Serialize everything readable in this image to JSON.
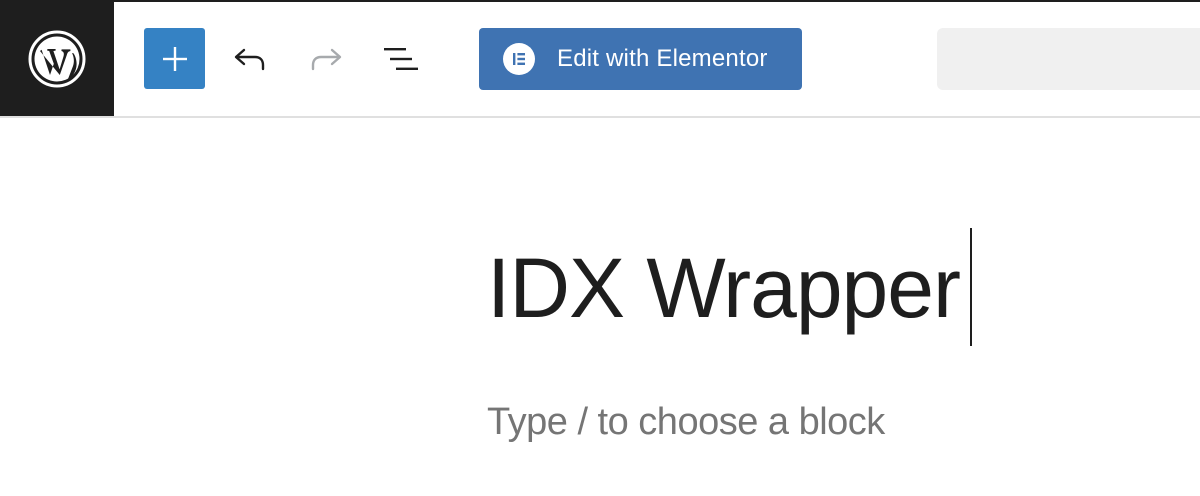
{
  "toolbar": {
    "logo_icon": "wordpress-logo-icon",
    "inserter_icon": "plus-icon",
    "undo_icon": "undo-arrow-icon",
    "redo_icon": "redo-arrow-icon",
    "outline_icon": "list-view-icon",
    "elementor_button_label": "Edit with Elementor",
    "elementor_icon": "elementor-icon",
    "search_placeholder": ""
  },
  "editor": {
    "title": "IDX Wrapper",
    "block_placeholder": "Type / to choose a block"
  },
  "colors": {
    "logo_background": "#1e1e1e",
    "inserter_blue": "#3582c4",
    "elementor_blue": "#3f73b2",
    "disabled_gray": "#a7aaad",
    "placeholder_gray": "#757575"
  }
}
